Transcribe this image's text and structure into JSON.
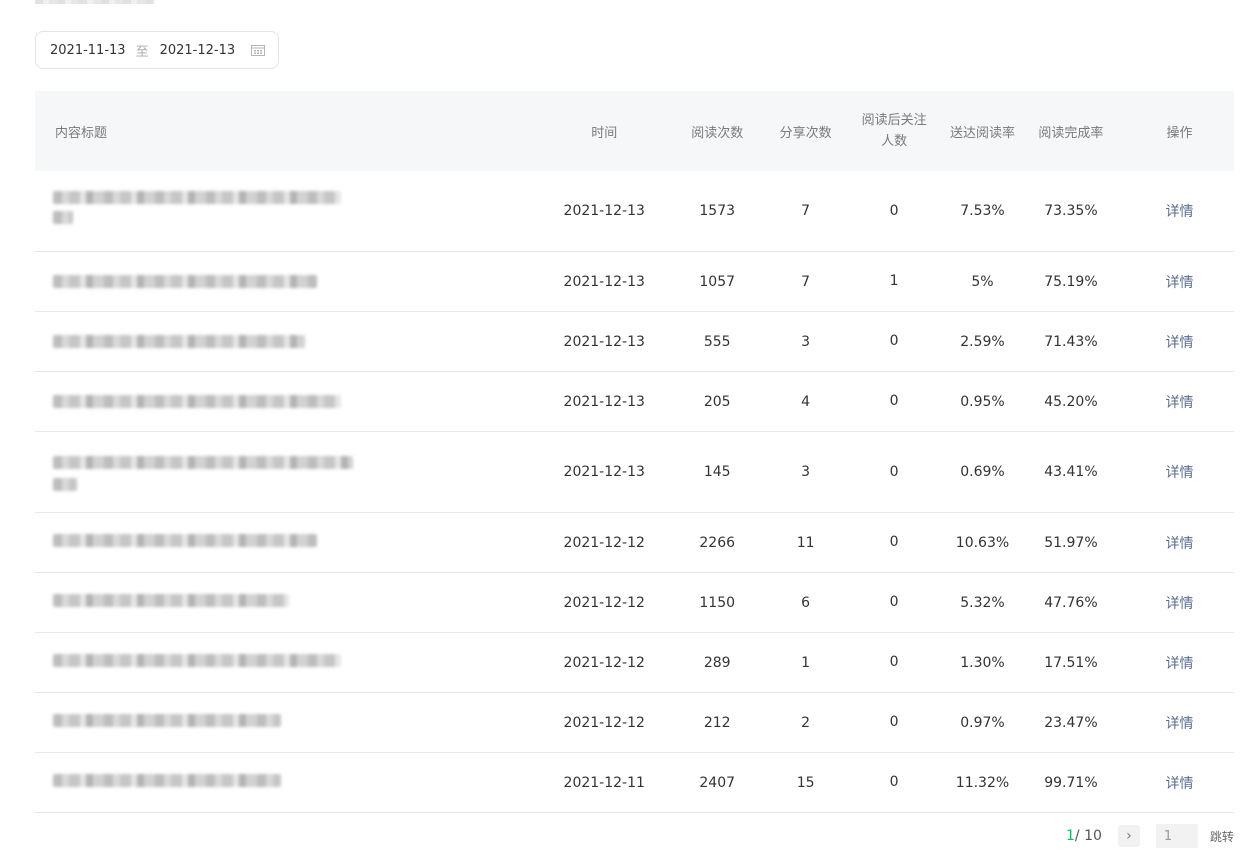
{
  "date_range": {
    "start": "2021-11-13",
    "separator": "至",
    "end": "2021-12-13"
  },
  "table": {
    "headers": {
      "title": "内容标题",
      "time": "时间",
      "reads": "阅读次数",
      "shares": "分享次数",
      "follows_line1": "阅读后关注",
      "follows_line2": "人数",
      "delivery_rate": "送达阅读率",
      "completion_rate": "阅读完成率",
      "action": "操作"
    },
    "rows": [
      {
        "time": "2021-12-13",
        "reads": "1573",
        "shares": "7",
        "follows": "0",
        "delivery_rate": "7.53%",
        "completion_rate": "73.35%",
        "action": "详情"
      },
      {
        "time": "2021-12-13",
        "reads": "1057",
        "shares": "7",
        "follows": "1",
        "delivery_rate": "5%",
        "completion_rate": "75.19%",
        "action": "详情"
      },
      {
        "time": "2021-12-13",
        "reads": "555",
        "shares": "3",
        "follows": "0",
        "delivery_rate": "2.59%",
        "completion_rate": "71.43%",
        "action": "详情"
      },
      {
        "time": "2021-12-13",
        "reads": "205",
        "shares": "4",
        "follows": "0",
        "delivery_rate": "0.95%",
        "completion_rate": "45.20%",
        "action": "详情"
      },
      {
        "time": "2021-12-13",
        "reads": "145",
        "shares": "3",
        "follows": "0",
        "delivery_rate": "0.69%",
        "completion_rate": "43.41%",
        "action": "详情"
      },
      {
        "time": "2021-12-12",
        "reads": "2266",
        "shares": "11",
        "follows": "0",
        "delivery_rate": "10.63%",
        "completion_rate": "51.97%",
        "action": "详情"
      },
      {
        "time": "2021-12-12",
        "reads": "1150",
        "shares": "6",
        "follows": "0",
        "delivery_rate": "5.32%",
        "completion_rate": "47.76%",
        "action": "详情"
      },
      {
        "time": "2021-12-12",
        "reads": "289",
        "shares": "1",
        "follows": "0",
        "delivery_rate": "1.30%",
        "completion_rate": "17.51%",
        "action": "详情"
      },
      {
        "time": "2021-12-12",
        "reads": "212",
        "shares": "2",
        "follows": "0",
        "delivery_rate": "0.97%",
        "completion_rate": "23.47%",
        "action": "详情"
      },
      {
        "time": "2021-12-11",
        "reads": "2407",
        "shares": "15",
        "follows": "0",
        "delivery_rate": "11.32%",
        "completion_rate": "99.71%",
        "action": "详情"
      }
    ]
  },
  "pagination": {
    "current": "1",
    "total": " / 10",
    "next_icon": "chevron-right-icon",
    "next_glyph": "›",
    "jump_input_value": "1",
    "jump_label": "跳转"
  }
}
